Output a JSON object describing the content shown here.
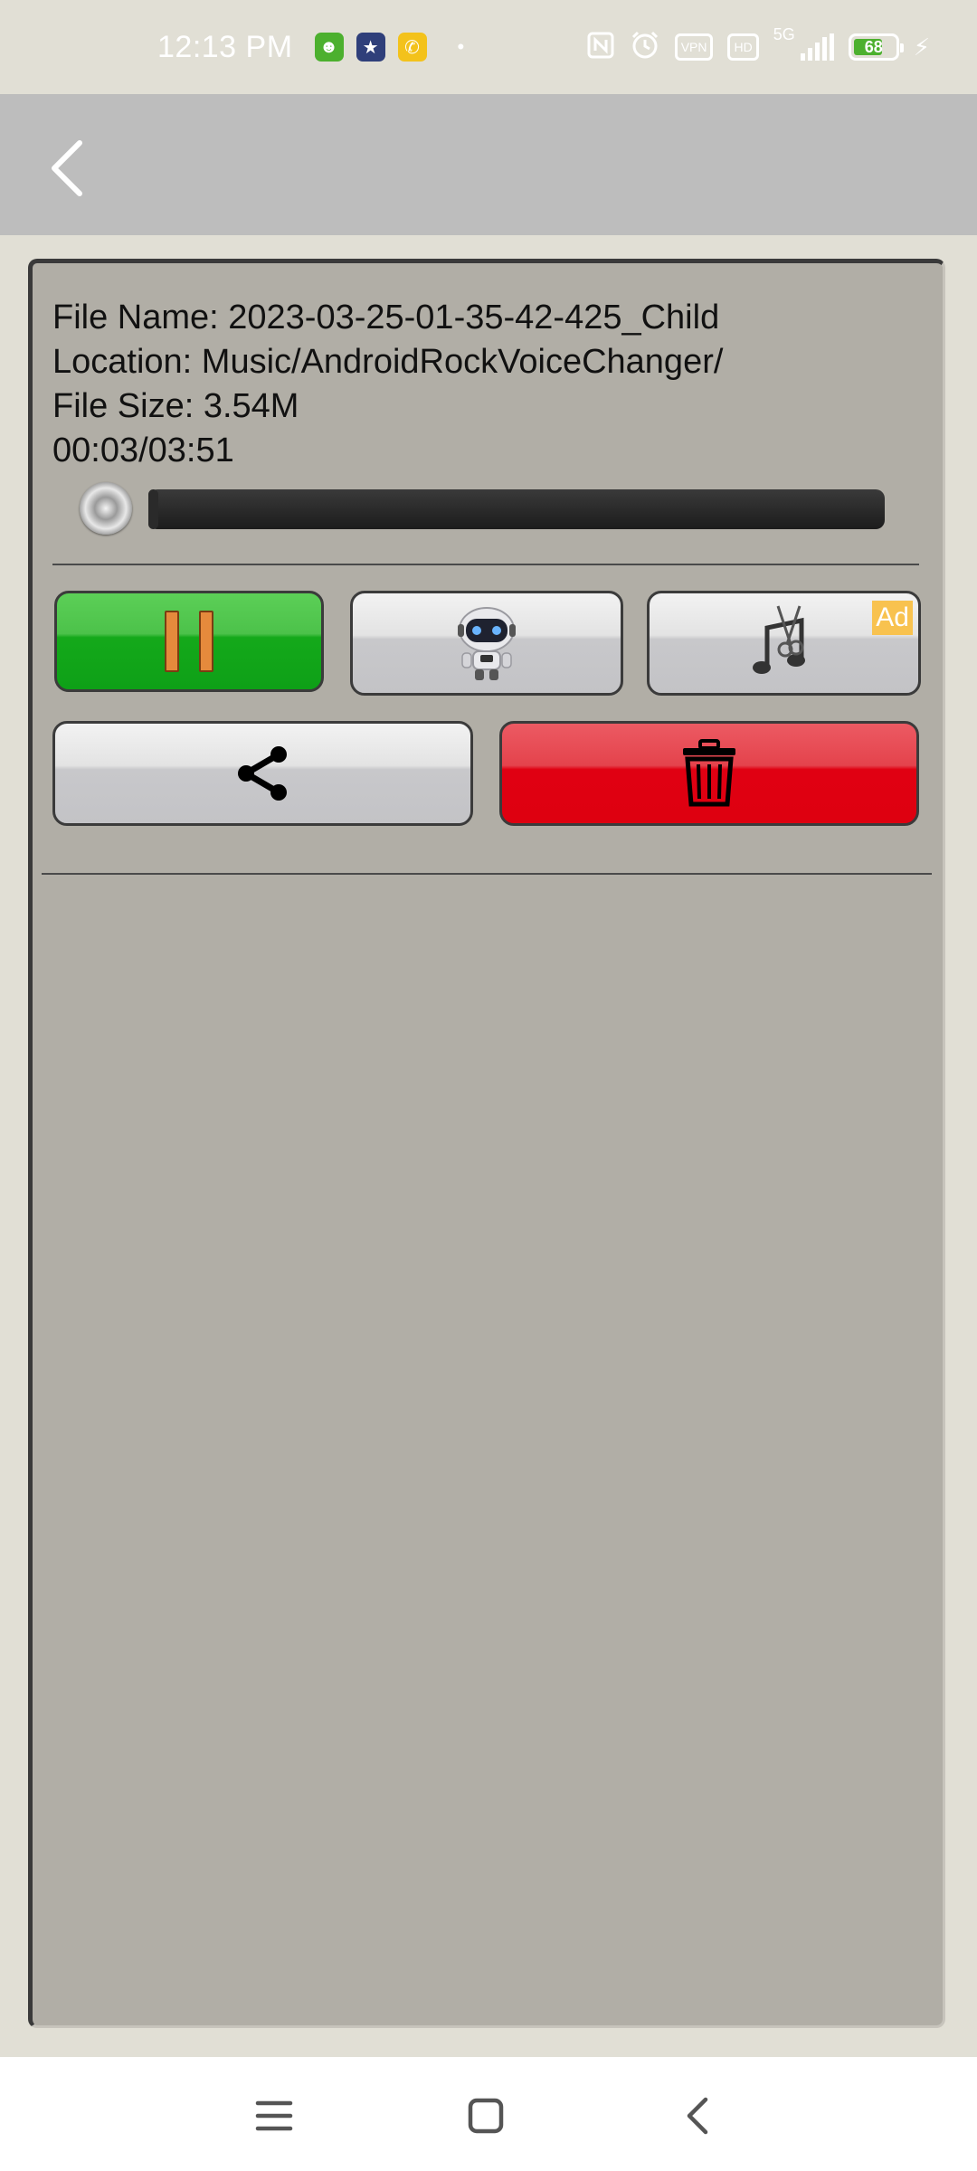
{
  "status_bar": {
    "time": "12:13 PM",
    "dot": "•",
    "vpn_label": "VPN",
    "hd_label": "HD",
    "network_label": "5G",
    "battery_level": "68",
    "icons": [
      "android-app-icon",
      "star-app-icon",
      "phone-app-icon",
      "nfc-icon",
      "alarm-icon",
      "vpn-icon",
      "hd-icon",
      "signal-icon",
      "battery-icon",
      "charging-icon"
    ]
  },
  "header": {
    "back_icon": "chevron-left-icon"
  },
  "file_info": {
    "name_line": "File Name: 2023-03-25-01-35-42-425_Child",
    "location_line": "Location: Music/AndroidRockVoiceChanger/",
    "size_line": "File Size: 3.54M",
    "time_line": "00:03/03:51"
  },
  "playback": {
    "progress_fraction": 0.013
  },
  "buttons": {
    "pause": {
      "icon": "pause-icon",
      "color": "#14a91a"
    },
    "robot": {
      "icon": "robot-icon"
    },
    "cut": {
      "icon": "music-scissors-icon",
      "ad_label": "Ad",
      "ad_color": "#f8c24f"
    },
    "share": {
      "icon": "share-icon"
    },
    "delete": {
      "icon": "trash-icon",
      "color": "#e00012"
    }
  },
  "nav_bar": {
    "icons": [
      "menu-icon",
      "home-icon",
      "back-icon"
    ]
  }
}
